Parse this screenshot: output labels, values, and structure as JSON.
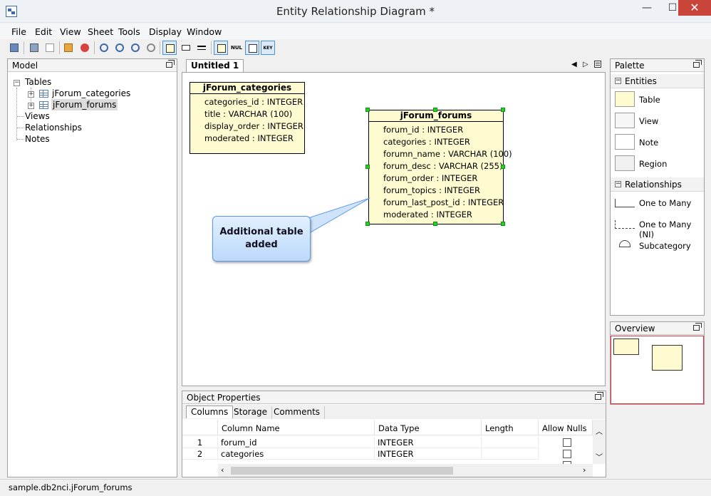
{
  "window": {
    "title": "Entity Relationship Diagram *",
    "minimize_glyph": "—",
    "maximize_glyph": "☐",
    "close_glyph": "✕"
  },
  "menu": [
    "File",
    "Edit",
    "View",
    "Sheet",
    "Tools",
    "Display",
    "Window"
  ],
  "toolbar": {
    "icons": [
      "save-icon",
      "print-icon",
      "page-setup-icon",
      "properties-icon",
      "stop-icon",
      "zoom-fit-icon",
      "zoom-in-icon",
      "zoom-out-icon",
      "zoom-reset-icon",
      "show-columns-icon",
      "show-datatypes-icon",
      "show-header-icon",
      "show-keys-icon",
      "show-nulls-icon",
      "show-indexes-icon",
      "show-relationships-icon"
    ],
    "null_label": "NUL",
    "key_label": "KEY"
  },
  "model": {
    "title": "Model",
    "tables_label": "Tables",
    "tables": [
      "jForum_categories",
      "jForum_forums"
    ],
    "views_label": "Views",
    "relationships_label": "Relationships",
    "notes_label": "Notes"
  },
  "document": {
    "tab": "Untitled 1"
  },
  "entities": [
    {
      "name": "jForum_categories",
      "columns": [
        "categories_id : INTEGER",
        "title : VARCHAR (100)",
        "display_order : INTEGER",
        "moderated : INTEGER"
      ]
    },
    {
      "name": "jForum_forums",
      "columns": [
        "forum_id : INTEGER",
        "categories : INTEGER",
        "forumn_name : VARCHAR (100)",
        "forum_desc : VARCHAR (255)",
        "forum_order : INTEGER",
        "forum_topics : INTEGER",
        "forum_last_post_id : INTEGER",
        "moderated : INTEGER"
      ]
    }
  ],
  "callout": {
    "line1": "Additional table",
    "line2": "added"
  },
  "palette": {
    "title": "Palette",
    "entities_label": "Entities",
    "entity_items": [
      "Table",
      "View",
      "Note",
      "Region"
    ],
    "relationships_label": "Relationships",
    "relationship_items": [
      "One to Many",
      "One to Many (NI)",
      "Subcategory"
    ]
  },
  "overview": {
    "title": "Overview"
  },
  "properties": {
    "title": "Object Properties",
    "tabs": [
      "Columns",
      "Storage",
      "Comments"
    ],
    "headers": [
      "Column Name",
      "Data Type",
      "Length",
      "Allow Nulls"
    ],
    "rows": [
      {
        "num": "1",
        "name": "forum_id",
        "type": "INTEGER",
        "length": ""
      },
      {
        "num": "2",
        "name": "categories",
        "type": "INTEGER",
        "length": ""
      }
    ]
  },
  "status": {
    "text": "sample.db2nci.jForum_forums"
  },
  "colors": {
    "accent": "#4a90d9",
    "entity_fill": "#fffbd0",
    "handle": "#21d321",
    "close_button": "#c9453a",
    "overview_frame": "#e0303a"
  }
}
